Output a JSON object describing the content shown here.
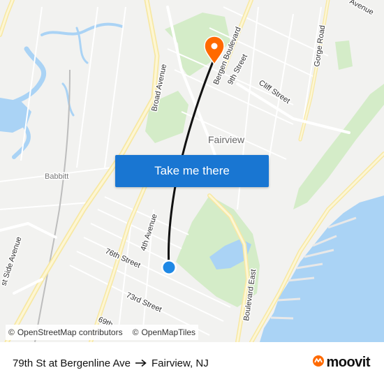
{
  "map": {
    "place_labels": {
      "fairview": "Fairview",
      "babbitt": "Babbitt"
    },
    "street_labels": {
      "broad_avenue": "Broad Avenue",
      "bergen_boulevard": "Bergen Boulevard",
      "ninth_street": "9th Street",
      "cliff_street": "Cliff Street",
      "gorge_road": "Gorge Road",
      "avenue_ne": "Avenue",
      "fourth_avenue": "4th Avenue",
      "seventy_sixth_street": "76th Street",
      "seventy_third_street": "73rd Street",
      "sixty_ninth_street": "69th",
      "boulevard_east": "Boulevard East",
      "east_side_avenue": "st Side Avenue"
    },
    "colors": {
      "route": "#111111",
      "origin": "#1e88e5",
      "destination_pin": "#ff6a00",
      "water": "#aad3f5",
      "park": "#d4ecc8"
    }
  },
  "cta": {
    "label": "Take me there"
  },
  "attribution": {
    "copyright_symbol": "©",
    "osm_contributors": "OpenStreetMap contributors",
    "openmaptiles": "OpenMapTiles"
  },
  "footer": {
    "from": "79th St at Bergenline Ave",
    "to": "Fairview, NJ",
    "brand": "moovit",
    "brand_color": "#ff6a00"
  }
}
